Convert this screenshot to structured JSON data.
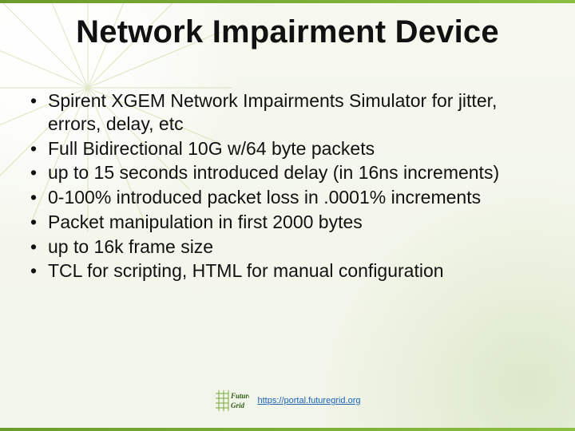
{
  "title": "Network Impairment Device",
  "bullets": [
    "Spirent XGEM Network Impairments Simulator for jitter, errors, delay, etc",
    "Full Bidirectional 10G w/64 byte packets",
    "up to 15 seconds introduced delay (in 16ns increments)",
    "0-100% introduced packet loss in .0001% increments",
    "Packet manipulation in first 2000 bytes",
    "up to 16k frame size",
    "TCL for scripting, HTML for manual configuration"
  ],
  "footer": {
    "url": "https://portal.futuregrid.org",
    "logo_text_top": "Future",
    "logo_text_bot": "Grid"
  },
  "colors": {
    "accent": "#6a9c2b"
  }
}
